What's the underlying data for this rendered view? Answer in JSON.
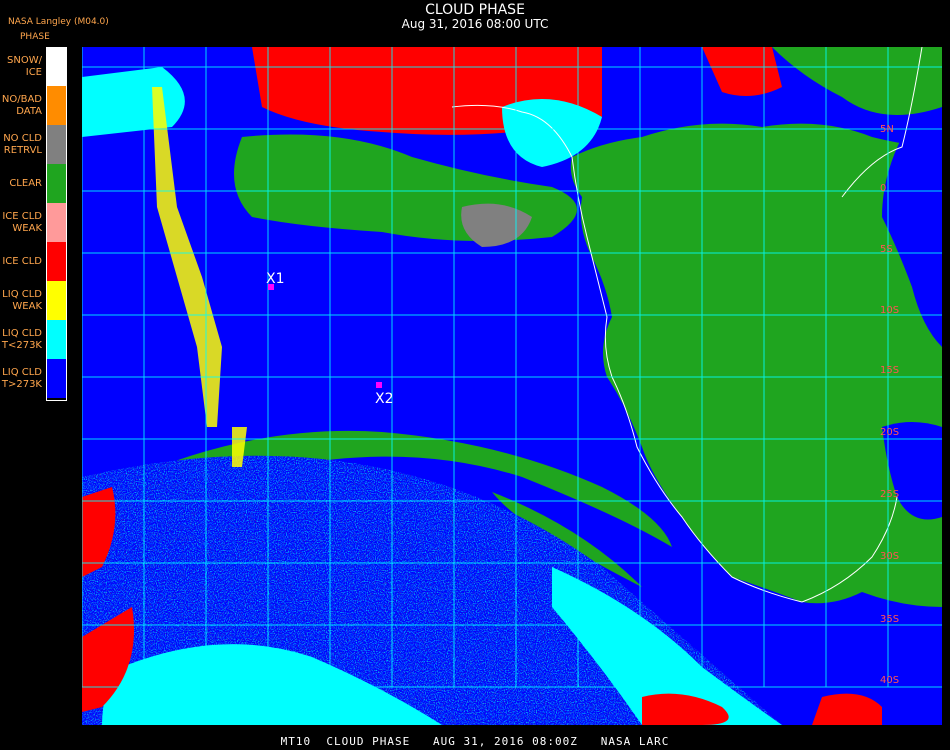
{
  "title": "CLOUD PHASE",
  "subtitle": "Aug 31, 2016 08:00 UTC",
  "legend": {
    "source": "NASA Langley (M04.0)",
    "heading": "PHASE",
    "items": [
      {
        "label": "SNOW/\nICE",
        "color": "#ffffff"
      },
      {
        "label": "NO/BAD\nDATA",
        "color": "#ff8c00"
      },
      {
        "label": "NO CLD\nRETRVL",
        "color": "#808080"
      },
      {
        "label": "CLEAR",
        "color": "#1fa51f"
      },
      {
        "label": "ICE CLD\nWEAK",
        "color": "#ff9a9a"
      },
      {
        "label": "ICE CLD",
        "color": "#ff0000"
      },
      {
        "label": "LIQ CLD\nWEAK",
        "color": "#ffff00"
      },
      {
        "label": "LIQ CLD\nT<273K",
        "color": "#00ffff"
      },
      {
        "label": "LIQ CLD\nT>273K",
        "color": "#0000ff"
      }
    ]
  },
  "markers": [
    {
      "label": "X1"
    },
    {
      "label": "X2"
    }
  ],
  "lat_labels": [
    "5N",
    "0",
    "5S",
    "10S",
    "15S",
    "20S",
    "25S",
    "30S",
    "35S",
    "40S"
  ],
  "footer": "MT10  CLOUD PHASE   AUG 31, 2016 08:00Z   NASA LARC"
}
